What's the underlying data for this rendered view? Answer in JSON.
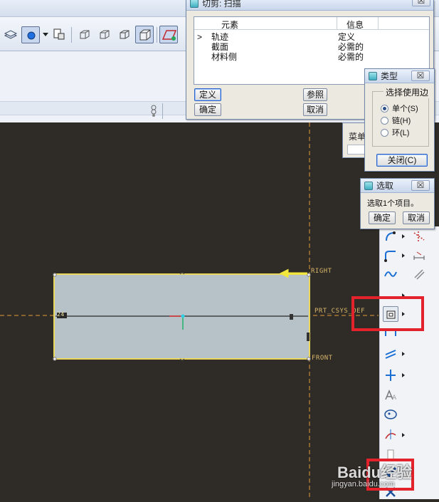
{
  "sweep_dialog": {
    "title": "切剪: 扫描",
    "columns": [
      "元素",
      "信息"
    ],
    "rows": [
      {
        "marker": ">",
        "element": "轨迹",
        "info": "定义"
      },
      {
        "marker": "",
        "element": "截面",
        "info": "必需的"
      },
      {
        "marker": "",
        "element": "材料侧",
        "info": "必需的"
      }
    ],
    "buttons": {
      "define": "定义",
      "refs": "参照",
      "ok": "确定",
      "cancel": "取消"
    }
  },
  "type_dialog": {
    "title": "类型",
    "close": "☒",
    "group_label": "选择使用边",
    "options": [
      {
        "label": "单个(S)",
        "selected": true
      },
      {
        "label": "链(H)",
        "selected": false
      },
      {
        "label": "环(L)",
        "selected": false
      }
    ],
    "close_button": "关闭(C)"
  },
  "select_dialog": {
    "title": "选取",
    "close": "☒",
    "message": "选取1个项目。",
    "buttons": {
      "ok": "确定",
      "cancel": "取消"
    }
  },
  "menu_fragment": {
    "label": "菜单"
  },
  "sweep_close": "☒",
  "canvas": {
    "labels": {
      "right": "RIGHT",
      "csys": "PRT_CSYS_DEF",
      "front": "FRONT",
      "mark": "24"
    },
    "colors": {
      "background": "#2f2c27",
      "rectangle_fill": "#b7c2c8",
      "rectangle_edge": "#e8d75b",
      "datum": "#e39a3a"
    }
  },
  "watermark": {
    "brand": "Baidu经验",
    "url": "jingyan.baidu.com"
  }
}
